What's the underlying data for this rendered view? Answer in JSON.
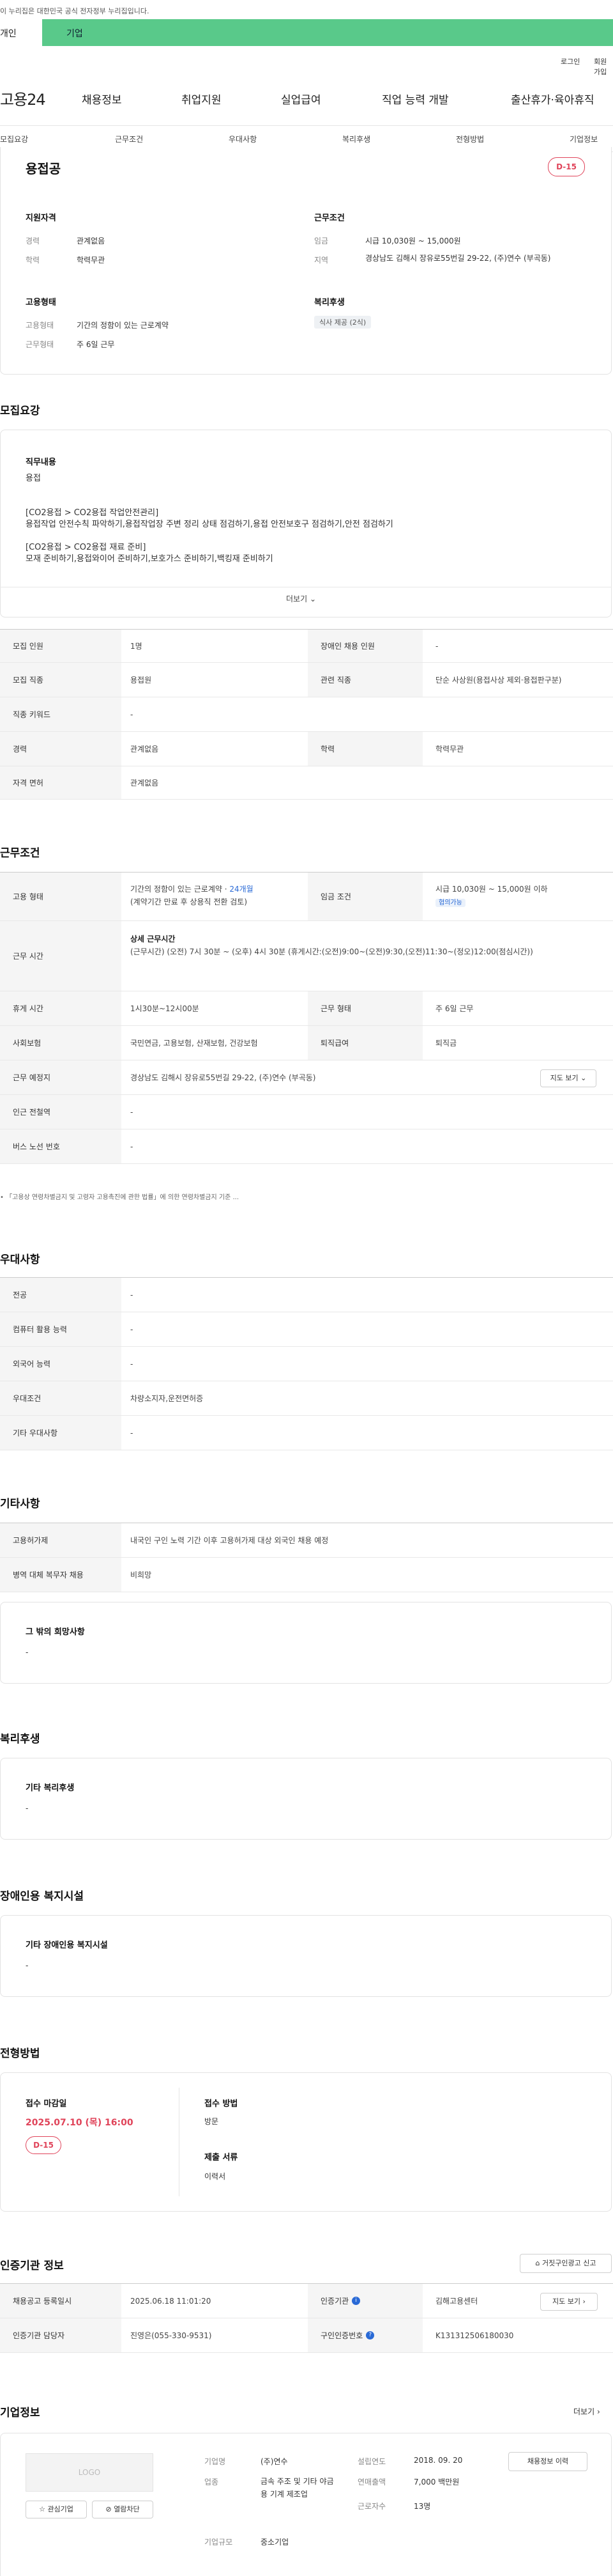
{
  "notice": "이 누리집은 대한민국 공식 전자정부 누리집입니다.",
  "tabs": {
    "individual": "개인",
    "corporate": "기업"
  },
  "util": {
    "login": "로그인",
    "signup": "회원가입"
  },
  "logo": "고용24",
  "gnb": [
    "채용정보",
    "취업지원",
    "실업급여",
    "직업 능력 개발",
    "출산휴가·육아휴직"
  ],
  "subnav": [
    "모집요강",
    "근무조건",
    "우대사항",
    "복리후생",
    "전형방법",
    "기업정보"
  ],
  "summary": {
    "title": "용접공",
    "dday": "D-15",
    "qual_head": "지원자격",
    "career_label": "경력",
    "career": "관계없음",
    "edu_label": "학력",
    "edu": "학력무관",
    "cond_head": "근무조건",
    "wage_label": "임금",
    "wage": "시급 10,030원 ~ 15,000원",
    "area_label": "지역",
    "area": "경상남도 김해시 장유로55번길 29-22, (주)연수 (부곡동)",
    "emp_head": "고용형태",
    "emptype_label": "고용형태",
    "emptype": "기간의 정함이 있는 근로계약",
    "hours_label": "근무형태",
    "hours": "주 6일 근무",
    "welfare_head": "복리후생",
    "welfare_tag": "식사 제공 (2식)"
  },
  "recruit": {
    "title": "모집요강",
    "duty_head": "직무내용",
    "duty_lines": [
      "용접",
      "",
      "",
      "[CO2용접 > CO2용접 작업안전관리]",
      "용접작업 안전수칙 파악하기,용접작업장 주변 정리 상태 점검하기,용접 안전보호구 점검하기,안전 점검하기",
      "",
      "[CO2용접 > CO2용접 재료 준비]",
      "모재 준비하기,용접와이어 준비하기,보호가스 준비하기,백킹재 준비하기"
    ],
    "more": "더보기",
    "rows": [
      {
        "h1": "모집 인원",
        "v1": "1명",
        "h2": "장애인 채용 인원",
        "v2": "-"
      },
      {
        "h1": "모집 직종",
        "v1": "용접원",
        "h2": "관련 직종",
        "v2": "단순 사상원(용접사상 제외·용접판구분)"
      },
      {
        "h1": "직종 키워드",
        "v1": "-"
      },
      {
        "h1": "경력",
        "v1": "관계없음",
        "h2": "학력",
        "v2": "학력무관"
      },
      {
        "h1": "자격 면허",
        "v1": "관계없음"
      }
    ]
  },
  "workcond": {
    "title": "근무조건",
    "emp_h": "고용 형태",
    "emp_v1": "기간의 정함이 있는 근로계약 · ",
    "emp_v1b": "24개월",
    "emp_v2": "(계약기간 만료 후 상용직 전환 검토)",
    "wage_h": "임금 조건",
    "wage_v": "시급 10,030원 ~ 15,000원 이하",
    "wage_tag": "협의가능",
    "time_h": "근무 시간",
    "time_sub": "상세 근무시간",
    "time_v": "(근무시간) (오전) 7시 30분 ~ (오후) 4시 30분 (휴게시간:(오전)9:00~(오전)9:30,(오전)11:30~(정오)12:00(점심시간))",
    "rest_h": "휴게 시간",
    "rest_v": "1시30분~12시00분",
    "form_h": "근무 형태",
    "form_v": "주 6일 근무",
    "ins_h": "사회보험",
    "ins_v": "국민연금, 고용보험, 산재보험, 건강보험",
    "ret_h": "퇴직급여",
    "ret_v": "퇴직금",
    "place_h": "근무 예정지",
    "place_v": "경상남도 김해시 장유로55번길 29-22, (주)연수 (부곡동)",
    "map": "지도 보기",
    "subway_h": "인근 전철역",
    "subway_v": "-",
    "bus_h": "버스 노선 번호",
    "bus_v": "-",
    "note": "• 「고용상 연령차별금지 및 고령자 고용촉진에 관한 법률」에 의한 연령차별금지 기준 ..."
  },
  "pref": {
    "title": "우대사항",
    "rows": [
      {
        "h": "전공",
        "v": "-"
      },
      {
        "h": "컴퓨터 활용 능력",
        "v": "-"
      },
      {
        "h": "외국어 능력",
        "v": "-"
      },
      {
        "h": "우대조건",
        "v": "차량소지자,운전면허증"
      },
      {
        "h": "기타 우대사항",
        "v": "-"
      }
    ]
  },
  "etc": {
    "title": "기타사항",
    "rows": [
      {
        "h": "고용허가제",
        "v": "내국인 구인 노력 기간 이후 고용허가제 대상 외국인 채용 예정"
      },
      {
        "h": "병역 대체 복무자 채용",
        "v": "비희망"
      }
    ],
    "hope_head": "그 밖의 희망사항",
    "hope_v": "-"
  },
  "welfare": {
    "title": "복리후생",
    "head": "기타 복리후생",
    "v": "-"
  },
  "disab": {
    "title": "장애인용 복지시설",
    "head": "기타 장애인용 복지시설",
    "v": "-"
  },
  "process": {
    "title": "전형방법",
    "deadline_h": "접수 마감일",
    "deadline_v": "2025.07.10 (목) 16:00",
    "dday": "D-15",
    "method_h": "접수 방법",
    "method_v": "방문",
    "docs_h": "제출 서류",
    "docs_v": "이력서"
  },
  "cert": {
    "title": "인증기관 정보",
    "report": "거짓구인광고 신고",
    "rows": [
      {
        "h1": "채용공고 등록일시",
        "v1": "2025.06.18 11:01:20",
        "h2": "인증기관",
        "v2": "김해고용센터",
        "btn": "지도 보기"
      },
      {
        "h1": "인증기관 담당자",
        "v1": "진영은(055-330-9531)",
        "h2": "구인인증번호",
        "v2": "K131312506180030"
      }
    ]
  },
  "company": {
    "title": "기업정보",
    "more": "더보기",
    "logo_text": "LOGO",
    "interest": "관심기업",
    "block": "열람차단",
    "name_h": "기업명",
    "name_v": "(주)연수",
    "ind_h": "업종",
    "ind_v": "금속 주조 및 기타 야금용 기계 제조업",
    "size_h": "기업규모",
    "size_v": "중소기업",
    "founded_h": "설립연도",
    "founded_v": "2018. 09. 20",
    "sales_h": "연매출액",
    "sales_v": "7,000 백만원",
    "emp_h": "근로자수",
    "emp_v": "13명",
    "jobinfo": "채용정보 이력"
  }
}
